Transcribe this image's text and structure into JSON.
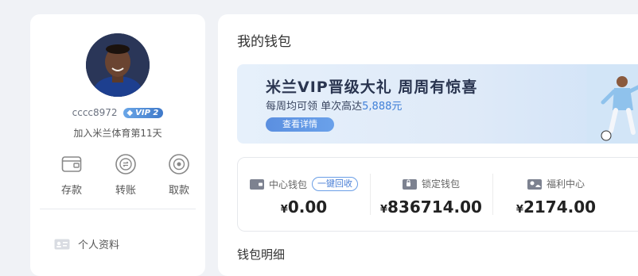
{
  "profile": {
    "username": "cccc8972",
    "vip_label": "VIP 2",
    "days_text": "加入米兰体育第11天"
  },
  "actions": [
    {
      "label": "存款",
      "icon": "wallet-icon"
    },
    {
      "label": "转账",
      "icon": "transfer-icon"
    },
    {
      "label": "取款",
      "icon": "withdraw-icon"
    }
  ],
  "menu": {
    "personal_info": "个人资料",
    "icon": "id-card-icon"
  },
  "main": {
    "title": "我的钱包",
    "banner": {
      "title": "米兰VIP晋级大礼 周周有惊喜",
      "sub_prefix": "每周均可领 单次高达",
      "sub_amount": "5,888元",
      "button": "查看详情"
    },
    "wallets": [
      {
        "label": "中心钱包",
        "currency": "¥",
        "amount": "0.00",
        "action": "一键回收",
        "icon": "center-wallet-icon"
      },
      {
        "label": "锁定钱包",
        "currency": "¥",
        "amount": "836714.00",
        "icon": "lock-wallet-icon"
      },
      {
        "label": "福利中心",
        "currency": "¥",
        "amount": "2174.00",
        "icon": "welfare-icon"
      }
    ],
    "detail_title": "钱包明细"
  },
  "colors": {
    "accent": "#4a7fd6",
    "background": "#f0f2f6"
  }
}
